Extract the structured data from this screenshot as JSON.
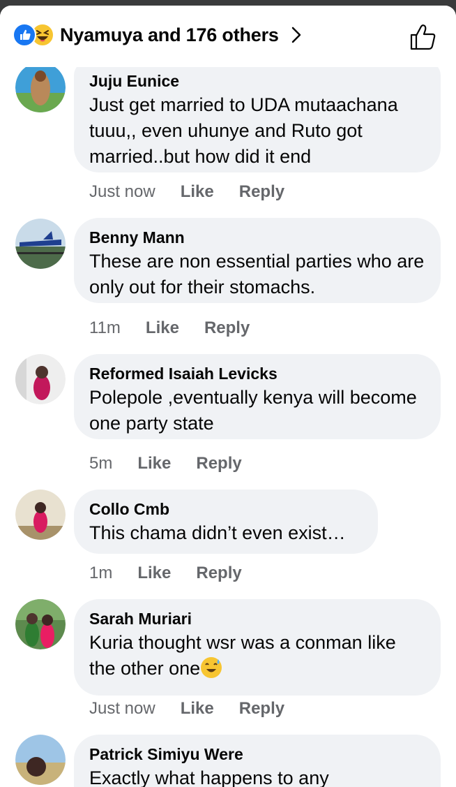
{
  "header": {
    "reaction_summary": "Nyamuya and 176 others",
    "reaction_icons": [
      "like-icon",
      "haha-icon"
    ],
    "like_icon": "thumbs-up-outline-icon"
  },
  "comments": [
    {
      "author": "Juju Eunice",
      "text": "Just get married to UDA mutaachana tuuu,, even uhunye and Ruto got married..but how did it end",
      "time": "Just now",
      "like": "Like",
      "reply": "Reply"
    },
    {
      "author": "Benny Mann",
      "text": "These are non essential parties  who are only out for their stomachs.",
      "time": "11m",
      "like": "Like",
      "reply": "Reply"
    },
    {
      "author": "Reformed Isaiah Levicks",
      "text": "Polepole  ,eventually kenya will become one party state",
      "time": "5m",
      "like": "Like",
      "reply": "Reply"
    },
    {
      "author": "Collo Cmb",
      "text": "This chama didn’t even exist…",
      "time": "1m",
      "like": "Like",
      "reply": "Reply"
    },
    {
      "author": "Sarah Muriari",
      "text": "Kuria thought wsr was a conman like the other one",
      "emoji": "grinning-sweat-emoji",
      "time": "Just now",
      "like": "Like",
      "reply": "Reply"
    },
    {
      "author": "Patrick Simiyu Were",
      "text": "Exactly what happens to any",
      "time": "",
      "like": "",
      "reply": ""
    }
  ],
  "colors": {
    "bubble": "#f0f2f5",
    "text": "#050505",
    "meta": "#65676b",
    "like_blue": "#1877f2",
    "haha_yellow": "#f7c531"
  }
}
